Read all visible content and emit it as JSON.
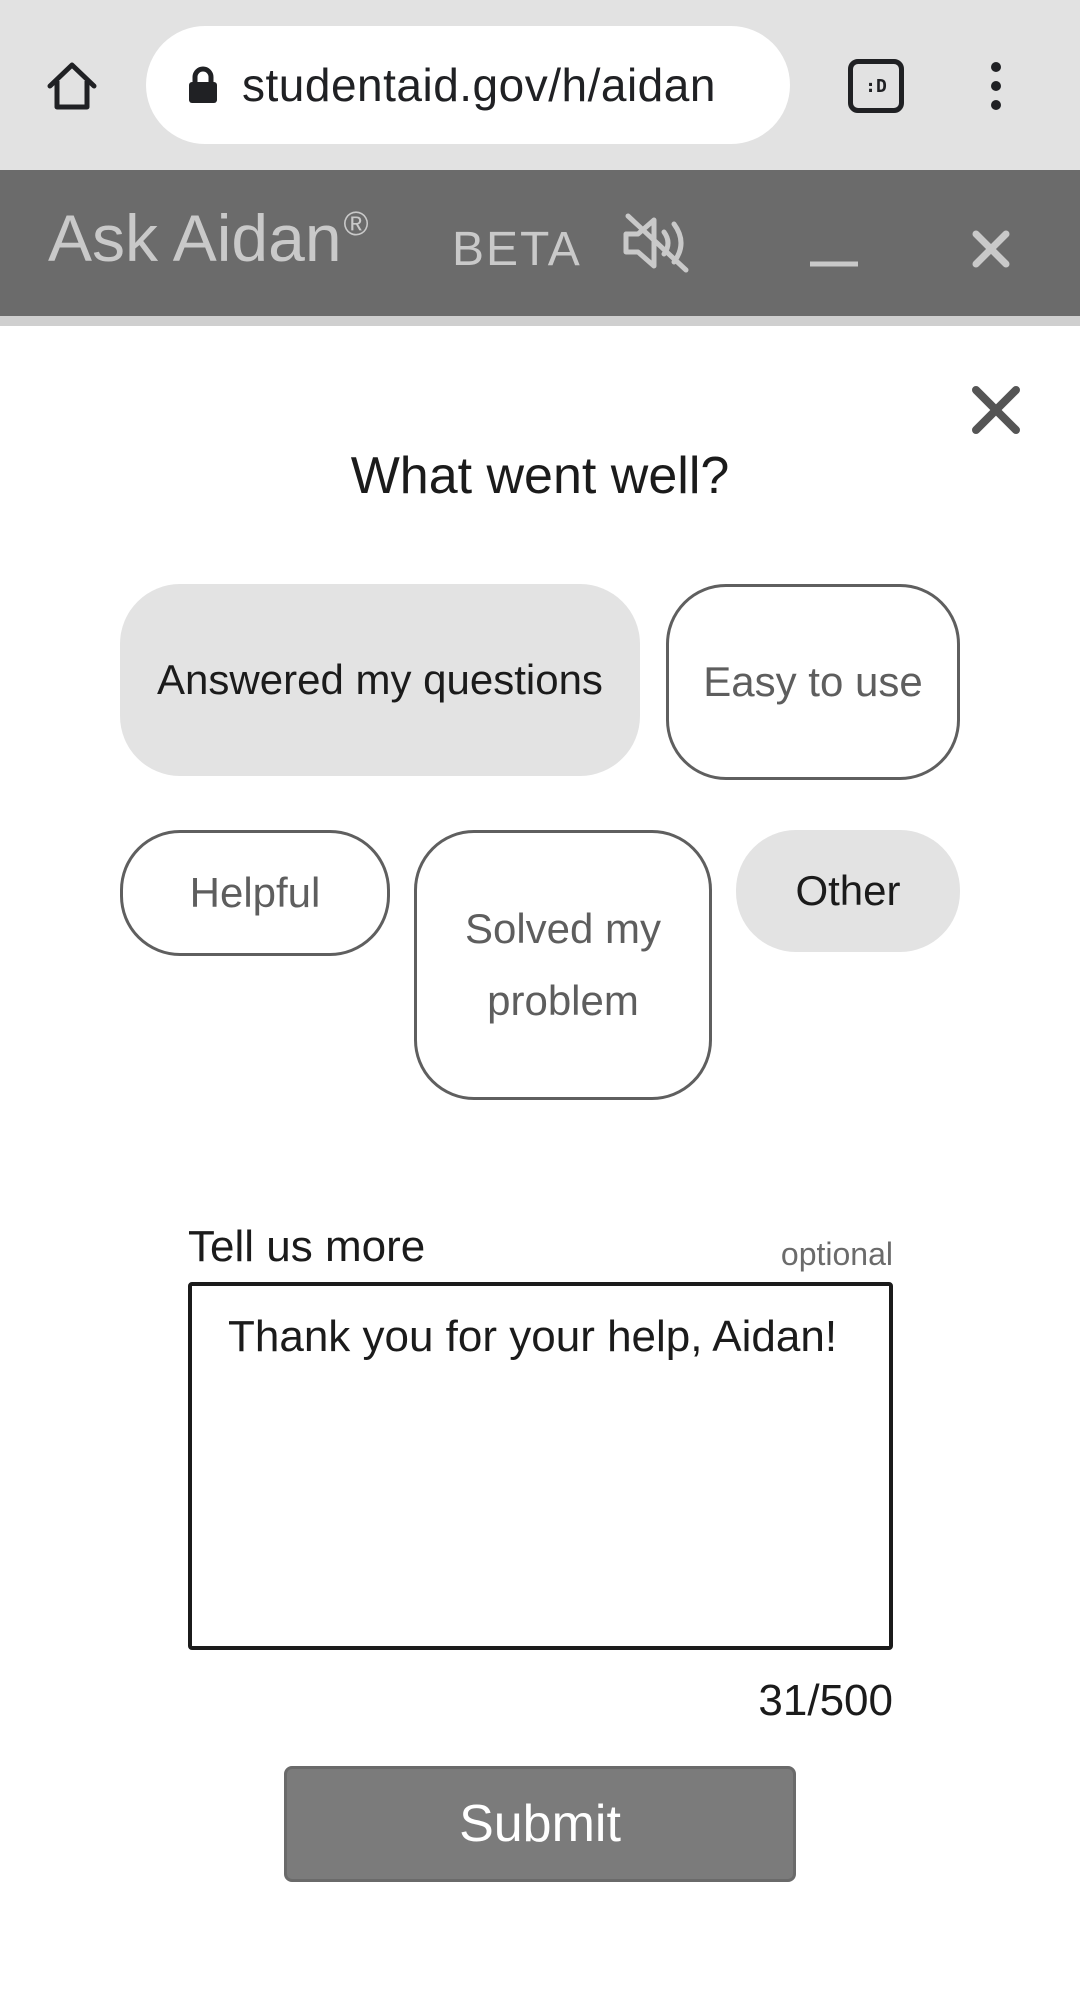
{
  "browser": {
    "url": "studentaid.gov/h/aidan",
    "tab_count_label": ":D",
    "icons": [
      "home-icon",
      "lock-icon",
      "tab-switcher-icon",
      "overflow-menu-icon"
    ]
  },
  "chat_header": {
    "title": "Ask Aidan",
    "registered_mark": "®",
    "beta_label": "BETA",
    "icons": [
      "sound-off-icon",
      "minimize-icon",
      "close-icon"
    ],
    "background_color": "#6b6b6b"
  },
  "feedback": {
    "question": "What went well?",
    "chips": [
      {
        "label": "Answered my questions",
        "selected": true
      },
      {
        "label": "Easy to use",
        "selected": false
      },
      {
        "label": "Helpful",
        "selected": false
      },
      {
        "label": "Solved my problem",
        "selected": false
      },
      {
        "label": "Other",
        "selected": true
      }
    ],
    "comment_label": "Tell us more",
    "comment_optional": "optional",
    "comment_value": "Thank you for your help, Aidan!",
    "char_count": "31/500",
    "submit_label": "Submit",
    "selected_chip_color": "#e3e3e3",
    "submit_color": "#7b7b7b"
  }
}
